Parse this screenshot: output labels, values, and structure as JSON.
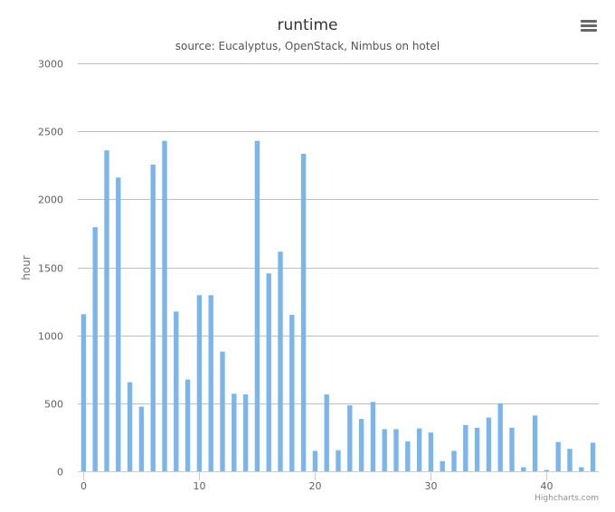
{
  "chart_data": {
    "type": "bar",
    "title": "runtime",
    "subtitle": "source: Eucalyptus, OpenStack, Nimbus on hotel",
    "xlabel": "",
    "ylabel": "hour",
    "ylim": [
      0,
      3000
    ],
    "xlim": [
      -0.5,
      44.5
    ],
    "yticks": [
      0,
      500,
      1000,
      1500,
      2000,
      2500,
      3000
    ],
    "xticks": [
      0,
      10,
      20,
      30,
      40
    ],
    "grid": true,
    "legend": "none",
    "color": "#7cb5ec",
    "x": [
      0,
      1,
      2,
      3,
      4,
      5,
      6,
      7,
      8,
      9,
      10,
      11,
      12,
      13,
      14,
      15,
      16,
      17,
      18,
      19,
      20,
      21,
      22,
      23,
      24,
      25,
      26,
      27,
      28,
      29,
      30,
      31,
      32,
      33,
      34,
      35,
      36,
      37,
      38,
      39,
      40,
      41,
      42,
      43,
      44
    ],
    "values": [
      1155,
      1795,
      2360,
      2160,
      655,
      475,
      2255,
      2430,
      1175,
      675,
      1295,
      1295,
      880,
      570,
      565,
      2430,
      1455,
      1615,
      1150,
      2335,
      150,
      565,
      155,
      485,
      385,
      510,
      310,
      310,
      220,
      315,
      285,
      75,
      150,
      340,
      320,
      395,
      500,
      320,
      30,
      410,
      10,
      215,
      165,
      30,
      210
    ]
  },
  "credit": "Highcharts.com",
  "menu": {
    "icon": "menu-icon"
  }
}
